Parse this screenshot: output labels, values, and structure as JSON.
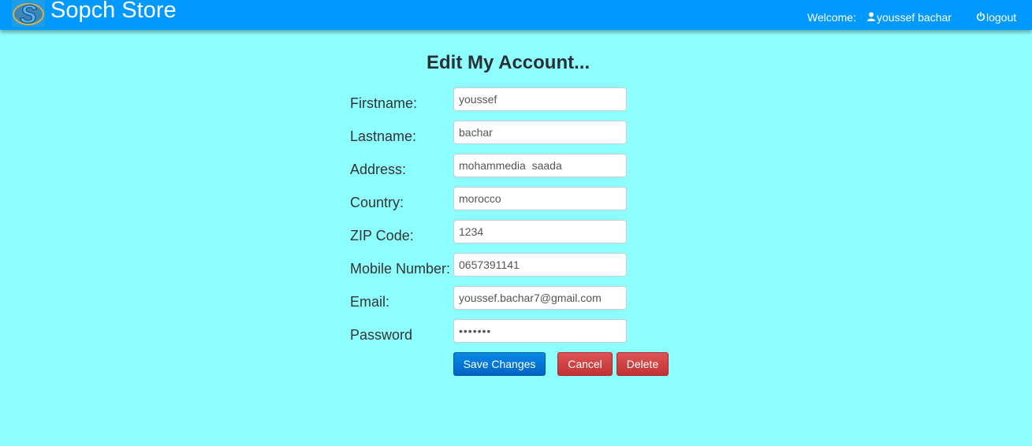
{
  "header": {
    "brand": "Sopch Store",
    "welcome_label": "Welcome:",
    "user_name": "youssef bachar",
    "logout_label": "logout"
  },
  "page": {
    "title": "Edit My Account..."
  },
  "form": {
    "firstname": {
      "label": "Firstname:",
      "value": "youssef"
    },
    "lastname": {
      "label": "Lastname:",
      "value": "bachar"
    },
    "address": {
      "label": "Address:",
      "value": "mohammedia  saada"
    },
    "country": {
      "label": "Country:",
      "value": "morocco"
    },
    "zip": {
      "label": "ZIP Code:",
      "value": "1234"
    },
    "mobile": {
      "label": "Mobile Number:",
      "value": "0657391141"
    },
    "email": {
      "label": "Email:",
      "value": "youssef.bachar7@gmail.com"
    },
    "password": {
      "label": "Password",
      "value": "•••••••"
    }
  },
  "actions": {
    "save_label": "Save Changes",
    "cancel_label": "Cancel",
    "delete_label": "Delete"
  },
  "colors": {
    "navbar": "#0099ff",
    "background": "#8effff",
    "save_button": "#0070d6",
    "danger_button": "#d04545"
  },
  "icons": {
    "logo": "sopch-logo-icon",
    "user": "user-icon",
    "logout": "power-icon"
  }
}
